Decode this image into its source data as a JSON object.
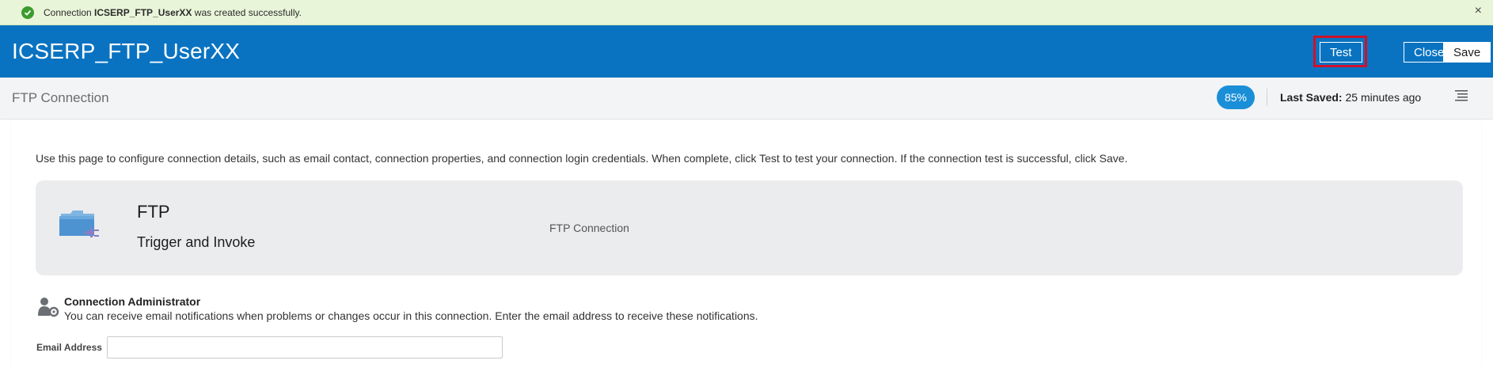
{
  "notification": {
    "prefix": "Connection ",
    "name": "ICSERP_FTP_UserXX",
    "suffix": " was created successfully.",
    "icon": "check-circle-icon",
    "close_glyph": "×"
  },
  "header": {
    "title": "ICSERP_FTP_UserXX",
    "buttons": {
      "test": "Test",
      "close": "Close",
      "save": "Save"
    }
  },
  "subheader": {
    "title": "FTP Connection",
    "progress": "85%",
    "last_saved_label": "Last Saved:",
    "last_saved_value": " 25 minutes ago",
    "menu_icon": "list-menu-icon"
  },
  "main": {
    "intro": "Use this page to configure connection details, such as email contact, connection properties, and connection login credentials. When complete, click Test to test your connection. If the connection test is successful, click Save.",
    "adapter": {
      "name": "FTP",
      "role": "Trigger and Invoke",
      "description": "FTP Connection",
      "icon": "ftp-adapter-icon"
    },
    "admin": {
      "title": "Connection Administrator",
      "description": "You can receive email notifications when problems or changes occur in this connection. Enter the email address to receive these notifications.",
      "icon": "admin-settings-icon"
    },
    "email": {
      "label": "Email Address",
      "value": "",
      "placeholder": ""
    }
  },
  "colors": {
    "header_bg": "#0a73c1",
    "banner_bg": "#e9f5d9",
    "success": "#3c9b2c",
    "badge": "#1a8fd8",
    "highlight": "#d0112b"
  }
}
